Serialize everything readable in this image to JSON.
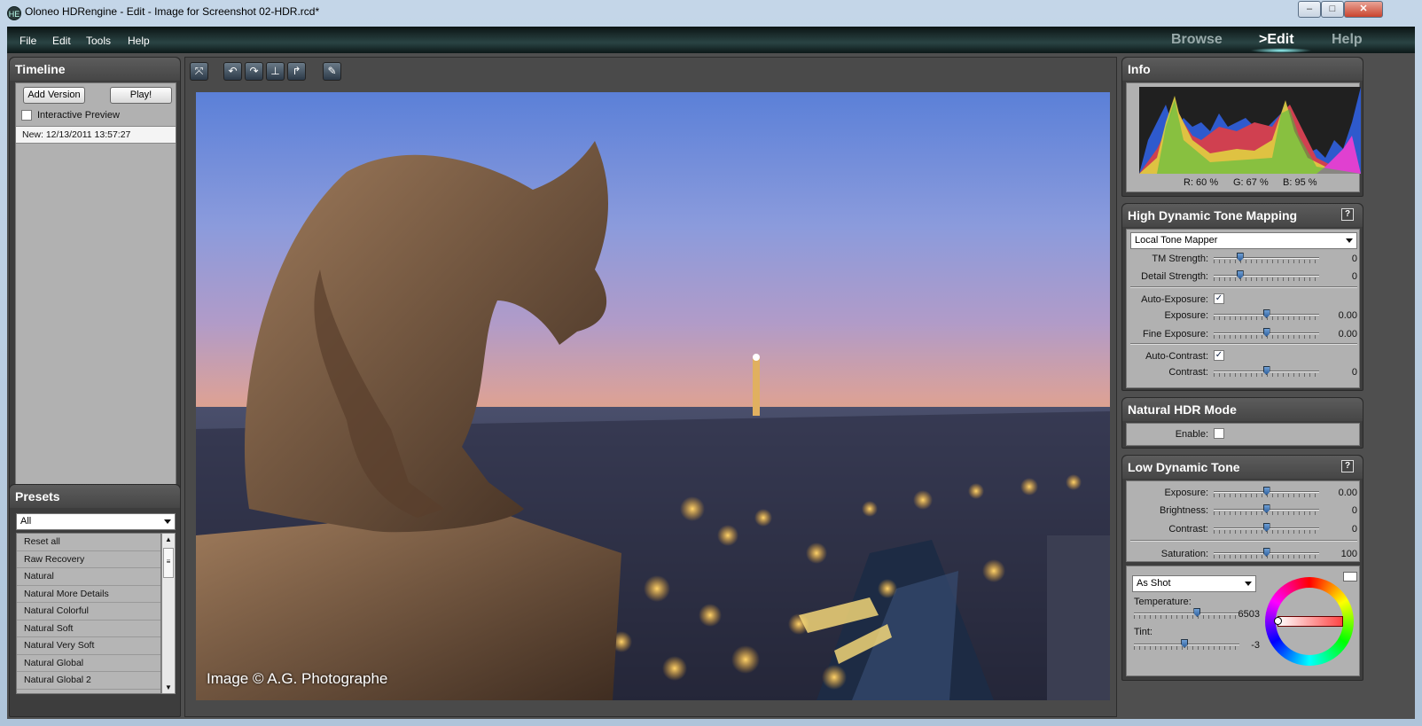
{
  "window": {
    "title": "Oloneo HDRengine - Edit - Image for Screenshot 02-HDR.rcd*",
    "app_icon": "oloneo-icon",
    "minimize": "–",
    "maximize": "□",
    "close": "✕"
  },
  "menu": {
    "file": "File",
    "edit": "Edit",
    "tools": "Tools",
    "help": "Help"
  },
  "modes": {
    "browse": "Browse",
    "edit": ">Edit",
    "help": "Help"
  },
  "timeline": {
    "title": "Timeline",
    "add_version": "Add Version",
    "play": "Play!",
    "interactive_preview": "Interactive Preview",
    "interactive_checked": false,
    "versions": [
      "New: 12/13/2011 13:57:27"
    ]
  },
  "presets": {
    "title": "Presets",
    "filter": "All",
    "items": [
      "Reset all",
      "Raw Recovery",
      "Natural",
      "Natural More Details",
      "Natural Colorful",
      "Natural Soft",
      "Natural Very Soft",
      "Natural Global",
      "Natural Global 2"
    ]
  },
  "toolbar": {
    "icons": [
      "fit-icon",
      "rotate-left-icon",
      "rotate-right-icon",
      "flip-icon",
      "rotate-icon",
      "eyedropper-icon"
    ]
  },
  "image": {
    "watermark": "Image © A.G. Photographe"
  },
  "info": {
    "title": "Info",
    "r": "R: 60 %",
    "g": "G: 67 %",
    "b": "B: 95 %"
  },
  "hdtm": {
    "title": "High Dynamic Tone Mapping",
    "help": "?",
    "mode": "Local Tone Mapper",
    "tm_strength": {
      "label": "TM Strength:",
      "value": "0",
      "level": 0.25
    },
    "detail_strength": {
      "label": "Detail Strength:",
      "value": "0",
      "level": 0.25
    },
    "auto_exposure": {
      "label": "Auto-Exposure:",
      "checked": true
    },
    "exposure": {
      "label": "Exposure:",
      "value": "0.00",
      "level": 0.5
    },
    "fine_exposure": {
      "label": "Fine Exposure:",
      "value": "0.00",
      "level": 0.5
    },
    "auto_contrast": {
      "label": "Auto-Contrast:",
      "checked": true
    },
    "contrast": {
      "label": "Contrast:",
      "value": "0",
      "level": 0.5
    }
  },
  "natural_hdr": {
    "title": "Natural HDR Mode",
    "enable_label": "Enable:",
    "enabled": false
  },
  "ldt": {
    "title": "Low Dynamic Tone",
    "help": "?",
    "exposure": {
      "label": "Exposure:",
      "value": "0.00",
      "level": 0.5
    },
    "brightness": {
      "label": "Brightness:",
      "value": "0",
      "level": 0.5
    },
    "contrast": {
      "label": "Contrast:",
      "value": "0",
      "level": 0.5
    },
    "saturation": {
      "label": "Saturation:",
      "value": "100",
      "level": 0.5
    },
    "white_balance": "As Shot",
    "temperature": {
      "label": "Temperature:",
      "value": "6503",
      "level": 0.6
    },
    "tint": {
      "label": "Tint:",
      "value": "-3",
      "level": 0.48
    }
  },
  "colors": {
    "accent": "#2f5f9a",
    "panel": "#3d3d3d",
    "menubar": "#1a2c2c"
  }
}
